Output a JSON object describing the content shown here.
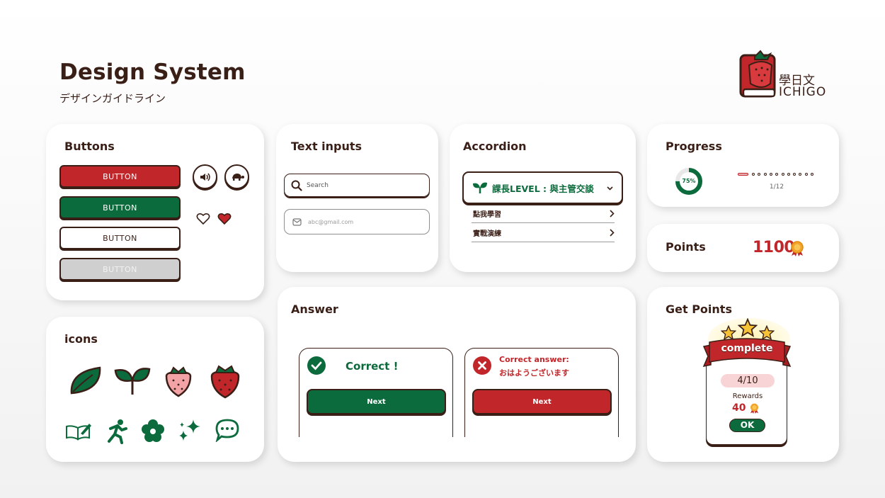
{
  "header": {
    "title": "Design System",
    "subtitle": "デザインガイドライン",
    "logo_text_line1": "學日文",
    "logo_text_line2": "ICHIGO"
  },
  "buttons_card": {
    "title": "Buttons",
    "primary_label": "BUTTON",
    "success_label": "BUTTON",
    "outline_label": "BUTTON",
    "disabled_label": "BUTTON"
  },
  "icons_card": {
    "title": "icons"
  },
  "text_inputs_card": {
    "title": "Text inputs",
    "search_placeholder": "Search",
    "email_placeholder": "abc@gmail.com"
  },
  "accordion_card": {
    "title": "Accordion",
    "header_label": "課長LEVEL : 與主管交談",
    "items": [
      {
        "label": "點我學習"
      },
      {
        "label": "實戰演練"
      }
    ]
  },
  "progress_card": {
    "title": "Progress",
    "ring_percent": 75,
    "ring_label": "75%",
    "step_current": 1,
    "step_total": 12,
    "step_label": "1/12"
  },
  "points_card": {
    "title": "Points",
    "value": "1100"
  },
  "answer_card": {
    "title": "Answer",
    "correct": {
      "message": "Correct !",
      "button_label": "Next"
    },
    "wrong": {
      "label": "Correct answer:",
      "answer": "おはようございます",
      "button_label": "Next"
    }
  },
  "get_points_card": {
    "title": "Get Points",
    "ribbon_label": "complete",
    "score": "4/10",
    "rewards_label": "Rewards",
    "rewards_value": "40",
    "ok_label": "OK",
    "stars": 3
  },
  "colors": {
    "brand_red": "#c0262a",
    "brand_green": "#0c6b3c",
    "dark_brown": "#3a1f17",
    "disabled_gray": "#cfcfcf"
  },
  "icons": [
    "leaf-icon",
    "sprout-icon",
    "pink-strawberry-icon",
    "red-strawberry-icon",
    "open-book-icon",
    "running-person-icon",
    "flower-icon",
    "sparkles-icon",
    "chat-bubble-icon",
    "speaker-icon",
    "turtle-icon",
    "heart-outline-icon",
    "heart-filled-icon",
    "search-icon",
    "mail-icon",
    "chevron-down-icon",
    "chevron-right-icon",
    "check-circle-icon",
    "x-circle-icon",
    "medal-icon",
    "star-icon"
  ]
}
